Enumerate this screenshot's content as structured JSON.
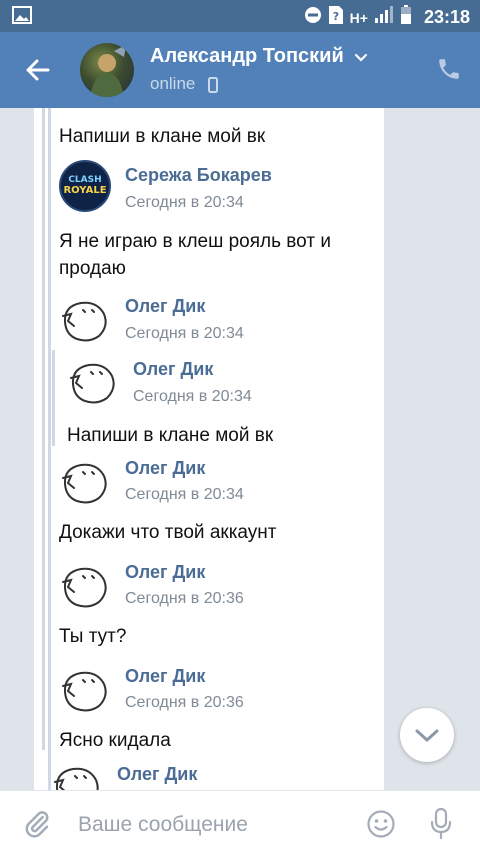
{
  "status_bar": {
    "time": "23:18",
    "network": "H+"
  },
  "header": {
    "name": "Александр Топский",
    "status": "online"
  },
  "messages": {
    "m1": {
      "text": "Напиши в клане мой вк"
    },
    "a1": {
      "name": "Сережа Бокарев",
      "time": "Сегодня в 20:34",
      "avatar_text_1": "CLASH",
      "avatar_text_2": "ROYALE"
    },
    "m2": {
      "line1": "Я не играю в клеш рояль вот и",
      "line2": "продаю"
    },
    "a2": {
      "name": "Олег Дик",
      "time": "Сегодня в 20:34"
    },
    "a3": {
      "name": "Олег Дик",
      "time": "Сегодня в 20:34"
    },
    "m3": {
      "text": "Напиши в клане мой вк"
    },
    "a4": {
      "name": "Олег Дик",
      "time": "Сегодня в 20:34"
    },
    "m4": {
      "text": "Докажи что твой аккаунт"
    },
    "a5": {
      "name": "Олег Дик",
      "time": "Сегодня в 20:36"
    },
    "m5": {
      "text": "Ты тут?"
    },
    "a6": {
      "name": "Олег Дик",
      "time": "Сегодня в 20:36"
    },
    "m6": {
      "text": "Ясно кидала"
    },
    "a7": {
      "name": "Олег Дик"
    }
  },
  "composer": {
    "placeholder": "Ваше сообщение"
  },
  "colors": {
    "header": "#5181b8",
    "status_bar": "#476c93",
    "link": "#4b6d95",
    "background": "#dfe4ea"
  }
}
